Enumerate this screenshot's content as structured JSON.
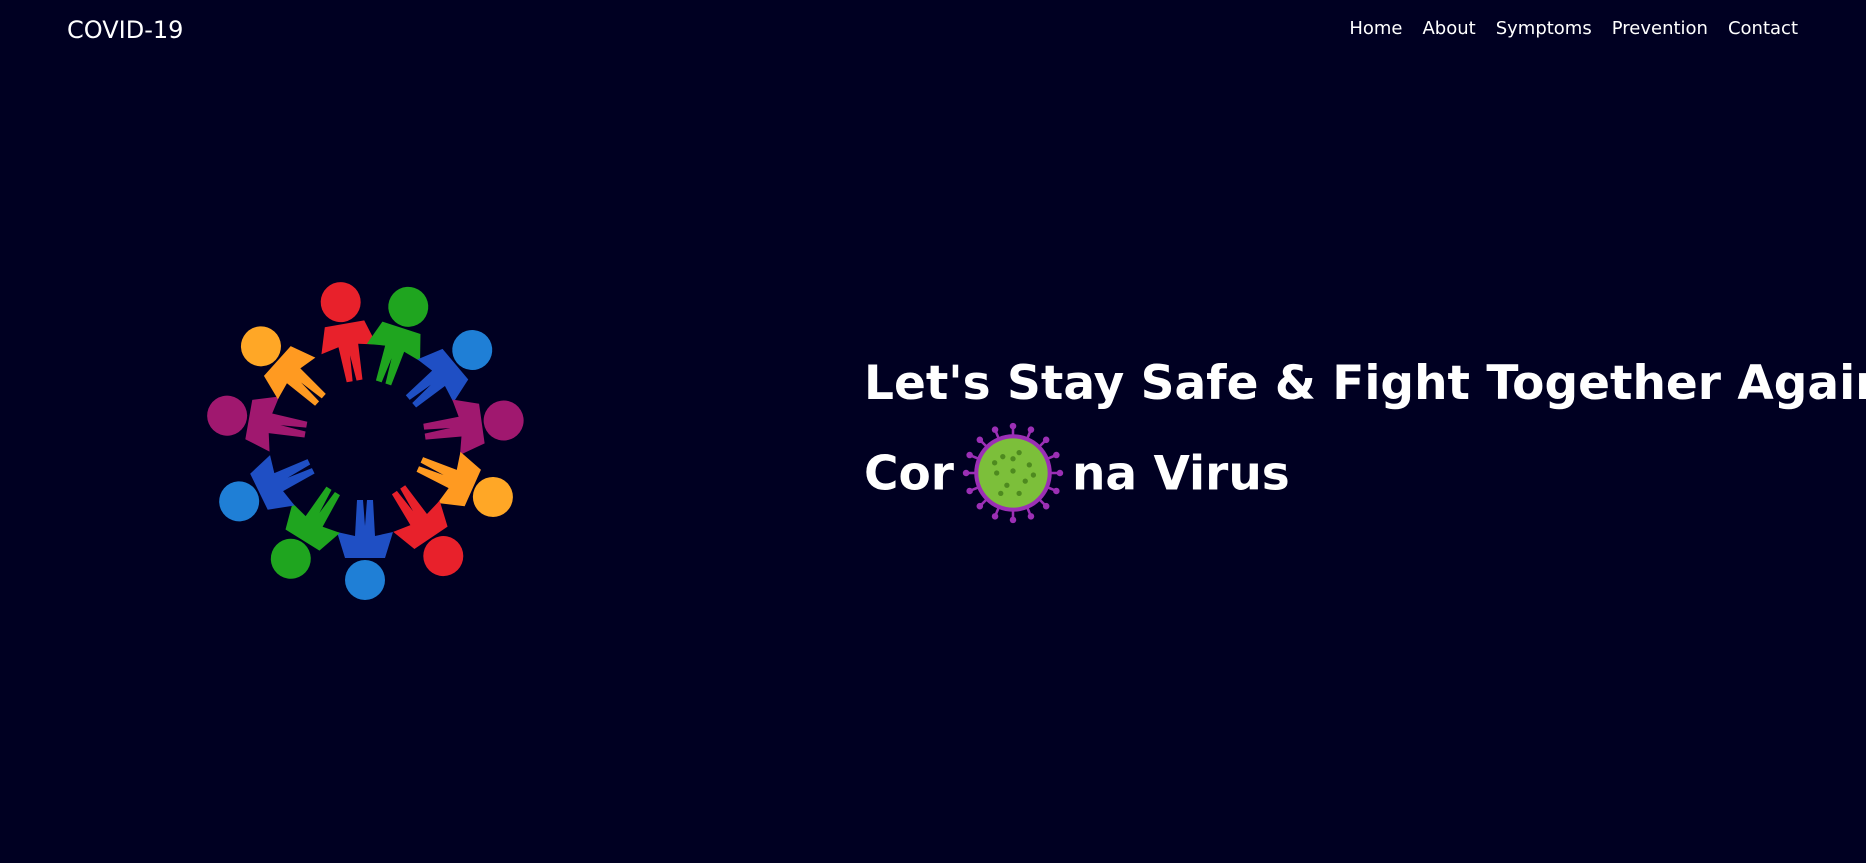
{
  "navbar": {
    "brand": "COVID-19",
    "links": [
      "Home",
      "About",
      "Symptoms",
      "Prevention",
      "Contact"
    ]
  },
  "hero": {
    "headline_line1": "Let's Stay Safe & Fight Together Against",
    "headline_line2_start": "Cor",
    "headline_line2_end": "na Virus",
    "illustration_icon": "people-circle-holding-hands-icon",
    "virus_icon": "coronavirus-icon"
  },
  "colors": {
    "background": "#000022",
    "text": "#ffffff",
    "people": [
      "#e8212b",
      "#1fa51f",
      "#1f4fc4",
      "#a0186f",
      "#ff9a21",
      "#1f7fd6"
    ],
    "virus_body": "#7cbf3a",
    "virus_spikes": "#9b2fb5"
  }
}
